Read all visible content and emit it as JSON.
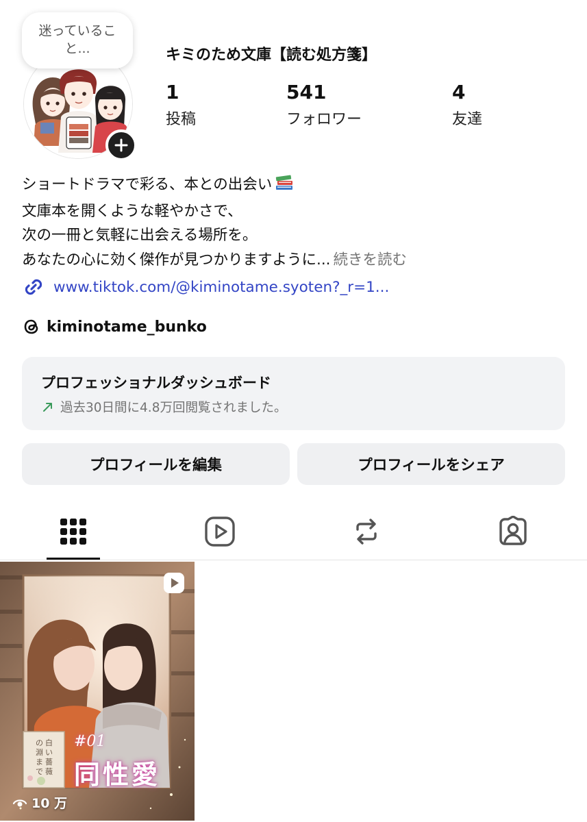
{
  "note": {
    "line1": "迷っているこ",
    "line2": "と..."
  },
  "profile": {
    "name": "キミのため文庫【読む処方箋】"
  },
  "stats": {
    "posts": {
      "value": "1",
      "label": "投稿"
    },
    "followers": {
      "value": "541",
      "label": "フォロワー"
    },
    "friends": {
      "value": "4",
      "label": "友達"
    }
  },
  "bio": {
    "lines": [
      "ショートドラマで彩る、本との出会い",
      "文庫本を開くような軽やかさで、",
      "次の一冊と気軽に出会える場所を。",
      "あなたの心に効く傑作が見つかりますように..."
    ],
    "read_more": "続きを読む",
    "link": "www.tiktok.com/@kiminotame.syoten?_r=1...",
    "threads_handle": "kiminotame_bunko"
  },
  "dashboard": {
    "title": "プロフェッショナルダッシュボード",
    "subtitle": "過去30日間に4.8万回閲覧されました。",
    "trend_color": "#3a9a5b"
  },
  "buttons": {
    "edit": "プロフィールを編集",
    "share": "プロフィールをシェア"
  },
  "tabs": [
    {
      "icon": "grid-icon",
      "active": true
    },
    {
      "icon": "reels-icon",
      "active": false
    },
    {
      "icon": "repost-icon",
      "active": false
    },
    {
      "icon": "tagged-icon",
      "active": false
    }
  ],
  "posts": [
    {
      "episode": "#01",
      "title": "同性愛",
      "book_title": "白い薔薇の淵まで",
      "views": "10 万"
    }
  ],
  "colors": {
    "link": "#3345c5",
    "muted": "#737373",
    "button_bg": "#eff0f2"
  }
}
